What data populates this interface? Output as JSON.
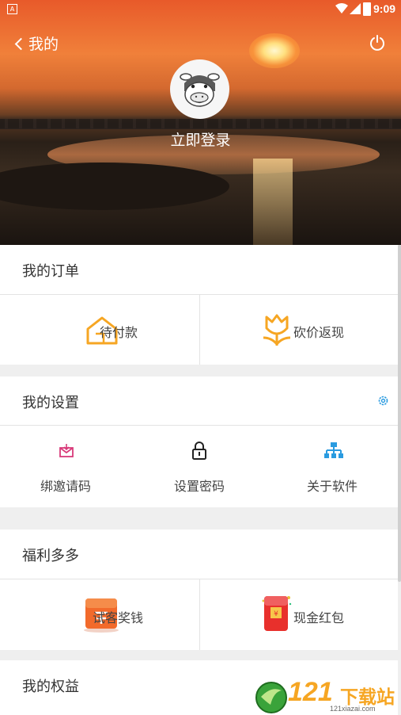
{
  "status_bar": {
    "time": "9:09",
    "notification_letter": "A"
  },
  "header": {
    "title": "我的",
    "login_label": "立即登录"
  },
  "orders": {
    "title": "我的订单",
    "items": [
      {
        "label": "待付款"
      },
      {
        "label": "砍价返现"
      }
    ]
  },
  "settings": {
    "title": "我的设置",
    "items": [
      {
        "label": "绑邀请码"
      },
      {
        "label": "设置密码"
      },
      {
        "label": "关于软件"
      }
    ]
  },
  "welfare": {
    "title": "福利多多",
    "items": [
      {
        "label": "试客奖钱"
      },
      {
        "label": "现金红包"
      }
    ]
  },
  "rights": {
    "title": "我的权益"
  },
  "watermark": {
    "number": "121",
    "text": "下载站",
    "domain": "121xiazai.com"
  },
  "colors": {
    "accent_orange": "#f6a623",
    "accent_pink": "#d93b7a",
    "accent_blue": "#2a9be0",
    "red_packet": "#e8302c",
    "bg": "#efefef"
  }
}
